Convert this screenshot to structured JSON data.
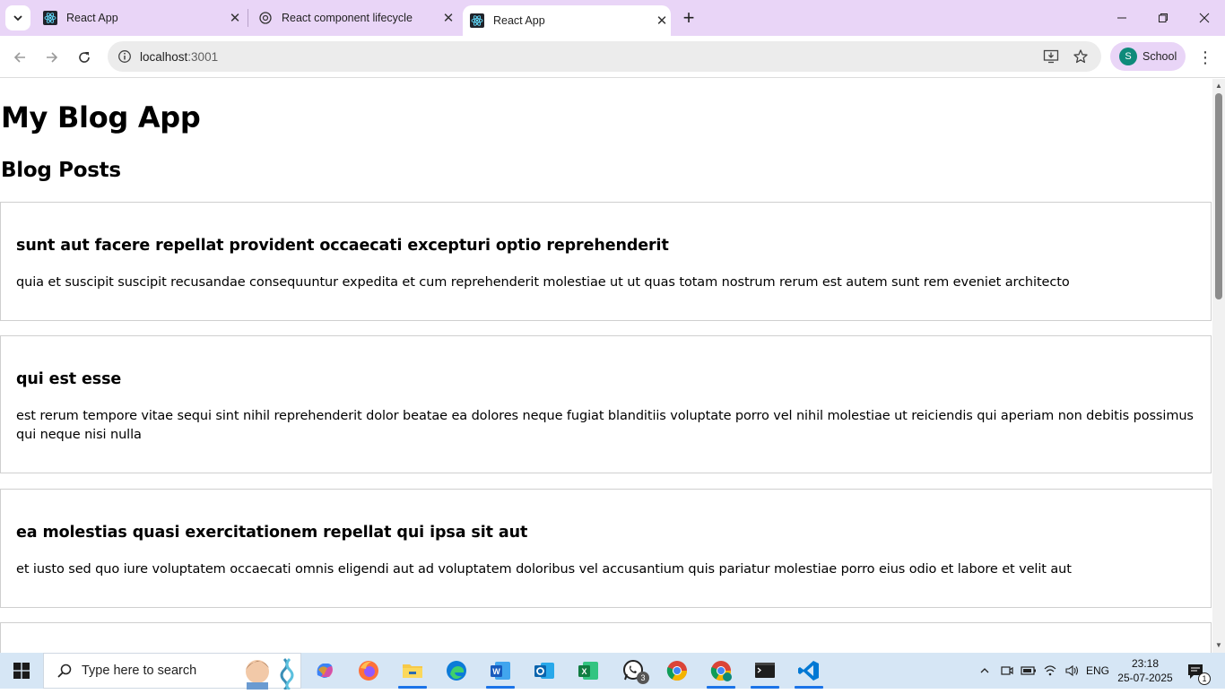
{
  "browser": {
    "tabs": [
      {
        "title": "React App",
        "active": false
      },
      {
        "title": "React component lifecycle",
        "active": false
      },
      {
        "title": "React App",
        "active": true
      }
    ],
    "url_host": "localhost",
    "url_port": ":3001",
    "profile_initial": "S",
    "profile_name": "School"
  },
  "page": {
    "title": "My Blog App",
    "section_title": "Blog Posts",
    "posts": [
      {
        "title": "sunt aut facere repellat provident occaecati excepturi optio reprehenderit",
        "body": "quia et suscipit suscipit recusandae consequuntur expedita et cum reprehenderit molestiae ut ut quas totam nostrum rerum est autem sunt rem eveniet architecto"
      },
      {
        "title": "qui est esse",
        "body": "est rerum tempore vitae sequi sint nihil reprehenderit dolor beatae ea dolores neque fugiat blanditiis voluptate porro vel nihil molestiae ut reiciendis qui aperiam non debitis possimus qui neque nisi nulla"
      },
      {
        "title": "ea molestias quasi exercitationem repellat qui ipsa sit aut",
        "body": "et iusto sed quo iure voluptatem occaecati omnis eligendi aut ad voluptatem doloribus vel accusantium quis pariatur molestiae porro eius odio et labore et velit aut"
      }
    ]
  },
  "taskbar": {
    "search_placeholder": "Type here to search",
    "whatsapp_badge": "3",
    "language": "ENG",
    "time": "23:18",
    "date": "25-07-2025",
    "notification_count": "1"
  },
  "colors": {
    "tabstrip": "#e9d5f7",
    "omnibox": "#ececec",
    "taskbar": "#d6e6f5",
    "profile_avatar": "#0e8a7a"
  }
}
